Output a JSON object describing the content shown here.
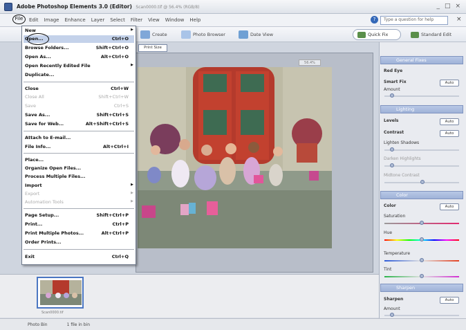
{
  "window": {
    "title": "Adobe Photoshop Elements 3.0 (Editor)",
    "document": "Scan0000.tif @ 56.4% (RGB/8)",
    "controls": [
      "_",
      "□",
      "×"
    ]
  },
  "menubar": {
    "items": [
      "File",
      "Edit",
      "Image",
      "Enhance",
      "Layer",
      "Select",
      "Filter",
      "View",
      "Window",
      "Help"
    ],
    "help_placeholder": "Type a question for help",
    "close": "×"
  },
  "toolbar": {
    "create": "Create",
    "photo_browser": "Photo Browser",
    "date_view": "Date View",
    "quick_fix": "Quick Fix",
    "standard_edit": "Standard Edit"
  },
  "options_bar": {
    "print_size": "Print Size"
  },
  "file_menu": {
    "items": [
      {
        "label": "New",
        "shortcut": "",
        "submenu": true,
        "disabled": false
      },
      {
        "label": "Open...",
        "shortcut": "Ctrl+O",
        "submenu": false,
        "disabled": false
      },
      {
        "label": "Browse Folders...",
        "shortcut": "Shift+Ctrl+O",
        "submenu": false,
        "disabled": false
      },
      {
        "label": "Open As...",
        "shortcut": "Alt+Ctrl+O",
        "submenu": false,
        "disabled": false
      },
      {
        "label": "Open Recently Edited File",
        "shortcut": "",
        "submenu": true,
        "disabled": false
      },
      {
        "label": "Duplicate...",
        "shortcut": "",
        "submenu": false,
        "disabled": false
      },
      {
        "label": "Close",
        "shortcut": "Ctrl+W",
        "submenu": false,
        "disabled": false
      },
      {
        "label": "Close All",
        "shortcut": "Shift+Ctrl+W",
        "submenu": false,
        "disabled": true
      },
      {
        "label": "Save",
        "shortcut": "Ctrl+S",
        "submenu": false,
        "disabled": true
      },
      {
        "label": "Save As...",
        "shortcut": "Shift+Ctrl+S",
        "submenu": false,
        "disabled": false
      },
      {
        "label": "Save for Web...",
        "shortcut": "Alt+Shift+Ctrl+S",
        "submenu": false,
        "disabled": false
      },
      {
        "label": "Attach to E-mail...",
        "shortcut": "",
        "submenu": false,
        "disabled": false
      },
      {
        "label": "File Info...",
        "shortcut": "Alt+Ctrl+I",
        "submenu": false,
        "disabled": false
      },
      {
        "label": "Place...",
        "shortcut": "",
        "submenu": false,
        "disabled": false
      },
      {
        "label": "Organize Open Files...",
        "shortcut": "",
        "submenu": false,
        "disabled": false
      },
      {
        "label": "Process Multiple Files...",
        "shortcut": "",
        "submenu": false,
        "disabled": false
      },
      {
        "label": "Import",
        "shortcut": "",
        "submenu": true,
        "disabled": false
      },
      {
        "label": "Export",
        "shortcut": "",
        "submenu": true,
        "disabled": true
      },
      {
        "label": "Automation Tools",
        "shortcut": "",
        "submenu": true,
        "disabled": true
      },
      {
        "label": "Page Setup...",
        "shortcut": "Shift+Ctrl+P",
        "submenu": false,
        "disabled": false
      },
      {
        "label": "Print...",
        "shortcut": "Ctrl+P",
        "submenu": false,
        "disabled": false
      },
      {
        "label": "Print Multiple Photos...",
        "shortcut": "Alt+Ctrl+P",
        "submenu": false,
        "disabled": false
      },
      {
        "label": "Order Prints...",
        "shortcut": "",
        "submenu": false,
        "disabled": false
      },
      {
        "label": "Exit",
        "shortcut": "Ctrl+Q",
        "submenu": false,
        "disabled": false
      }
    ]
  },
  "palette": {
    "general_fixes": {
      "title": "General Fixes",
      "red_eye": "Red Eye",
      "smart_fix": "Smart Fix",
      "amount": "Amount",
      "auto": "Auto"
    },
    "lighting": {
      "title": "Lighting",
      "levels": "Levels",
      "contrast": "Contrast",
      "lighten_shadows": "Lighten Shadows",
      "darken_highlights": "Darken Highlights",
      "midtone_contrast": "Midtone Contrast",
      "auto": "Auto"
    },
    "color": {
      "title": "Color",
      "color": "Color",
      "saturation": "Saturation",
      "hue": "Hue",
      "temperature": "Temperature",
      "tint": "Tint",
      "auto": "Auto"
    },
    "sharpen": {
      "title": "Sharpen",
      "sharpen": "Sharpen",
      "amount": "Amount",
      "auto": "Auto"
    }
  },
  "photo_bin": {
    "caption": "Scan0000.tif"
  },
  "statusbar": {
    "bin_label": "Photo Bin",
    "count": "1 file in bin"
  },
  "canvas": {
    "zoom": "56.4%"
  },
  "colors": {
    "accent": "#4a76c2",
    "menu_highlight": "#c4d2ea",
    "palette_header": "#9fb2d8"
  }
}
